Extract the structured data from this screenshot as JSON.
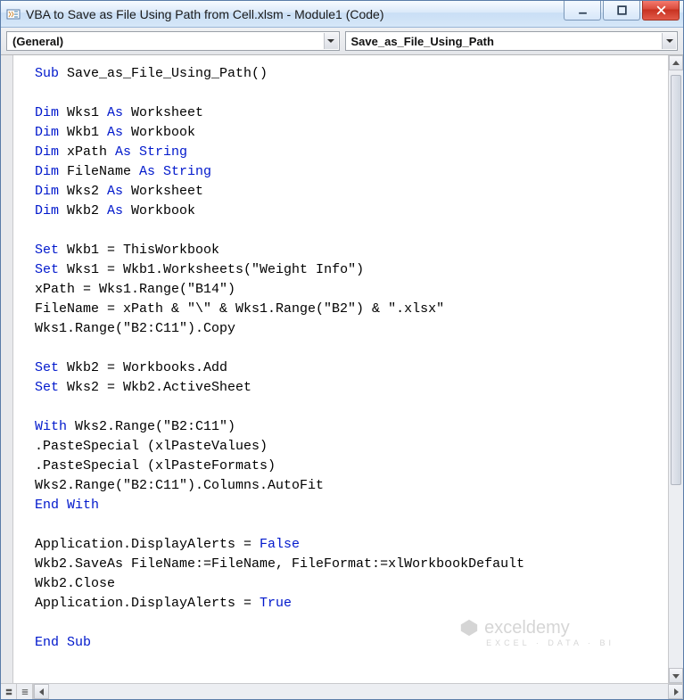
{
  "titlebar": {
    "title": "VBA to Save as File Using Path from Cell.xlsm - Module1 (Code)"
  },
  "dropdowns": {
    "object": "(General)",
    "procedure": "Save_as_File_Using_Path"
  },
  "watermark": {
    "brand": "exceldemy",
    "tagline": "EXCEL · DATA · BI"
  },
  "code": {
    "lines": [
      {
        "tokens": [
          {
            "t": "Sub ",
            "k": true
          },
          {
            "t": "Save_as_File_Using_Path()",
            "k": false
          }
        ]
      },
      {
        "tokens": []
      },
      {
        "tokens": [
          {
            "t": "Dim ",
            "k": true
          },
          {
            "t": "Wks1 ",
            "k": false
          },
          {
            "t": "As ",
            "k": true
          },
          {
            "t": "Worksheet",
            "k": false
          }
        ]
      },
      {
        "tokens": [
          {
            "t": "Dim ",
            "k": true
          },
          {
            "t": "Wkb1 ",
            "k": false
          },
          {
            "t": "As ",
            "k": true
          },
          {
            "t": "Workbook",
            "k": false
          }
        ]
      },
      {
        "tokens": [
          {
            "t": "Dim ",
            "k": true
          },
          {
            "t": "xPath ",
            "k": false
          },
          {
            "t": "As String",
            "k": true
          }
        ]
      },
      {
        "tokens": [
          {
            "t": "Dim ",
            "k": true
          },
          {
            "t": "FileName ",
            "k": false
          },
          {
            "t": "As String",
            "k": true
          }
        ]
      },
      {
        "tokens": [
          {
            "t": "Dim ",
            "k": true
          },
          {
            "t": "Wks2 ",
            "k": false
          },
          {
            "t": "As ",
            "k": true
          },
          {
            "t": "Worksheet",
            "k": false
          }
        ]
      },
      {
        "tokens": [
          {
            "t": "Dim ",
            "k": true
          },
          {
            "t": "Wkb2 ",
            "k": false
          },
          {
            "t": "As ",
            "k": true
          },
          {
            "t": "Workbook",
            "k": false
          }
        ]
      },
      {
        "tokens": []
      },
      {
        "tokens": [
          {
            "t": "Set ",
            "k": true
          },
          {
            "t": "Wkb1 = ThisWorkbook",
            "k": false
          }
        ]
      },
      {
        "tokens": [
          {
            "t": "Set ",
            "k": true
          },
          {
            "t": "Wks1 = Wkb1.Worksheets(\"Weight Info\")",
            "k": false
          }
        ]
      },
      {
        "tokens": [
          {
            "t": "xPath = Wks1.Range(\"B14\")",
            "k": false
          }
        ]
      },
      {
        "tokens": [
          {
            "t": "FileName = xPath & \"\\\" & Wks1.Range(\"B2\") & \".xlsx\"",
            "k": false
          }
        ]
      },
      {
        "tokens": [
          {
            "t": "Wks1.Range(\"B2:C11\").Copy",
            "k": false
          }
        ]
      },
      {
        "tokens": []
      },
      {
        "tokens": [
          {
            "t": "Set ",
            "k": true
          },
          {
            "t": "Wkb2 = Workbooks.Add",
            "k": false
          }
        ]
      },
      {
        "tokens": [
          {
            "t": "Set ",
            "k": true
          },
          {
            "t": "Wks2 = Wkb2.ActiveSheet",
            "k": false
          }
        ]
      },
      {
        "tokens": []
      },
      {
        "tokens": [
          {
            "t": "With ",
            "k": true
          },
          {
            "t": "Wks2.Range(\"B2:C11\")",
            "k": false
          }
        ]
      },
      {
        "tokens": [
          {
            "t": ".PasteSpecial (xlPasteValues)",
            "k": false
          }
        ]
      },
      {
        "tokens": [
          {
            "t": ".PasteSpecial (xlPasteFormats)",
            "k": false
          }
        ]
      },
      {
        "tokens": [
          {
            "t": "Wks2.Range(\"B2:C11\").Columns.AutoFit",
            "k": false
          }
        ]
      },
      {
        "tokens": [
          {
            "t": "End With",
            "k": true
          }
        ]
      },
      {
        "tokens": []
      },
      {
        "tokens": [
          {
            "t": "Application.DisplayAlerts = ",
            "k": false
          },
          {
            "t": "False",
            "k": true
          }
        ]
      },
      {
        "tokens": [
          {
            "t": "Wkb2.SaveAs FileName:=FileName, FileFormat:=xlWorkbookDefault",
            "k": false
          }
        ]
      },
      {
        "tokens": [
          {
            "t": "Wkb2.Close",
            "k": false
          }
        ]
      },
      {
        "tokens": [
          {
            "t": "Application.DisplayAlerts = ",
            "k": false
          },
          {
            "t": "True",
            "k": true
          }
        ]
      },
      {
        "tokens": []
      },
      {
        "tokens": [
          {
            "t": "End Sub",
            "k": true
          }
        ]
      }
    ]
  }
}
